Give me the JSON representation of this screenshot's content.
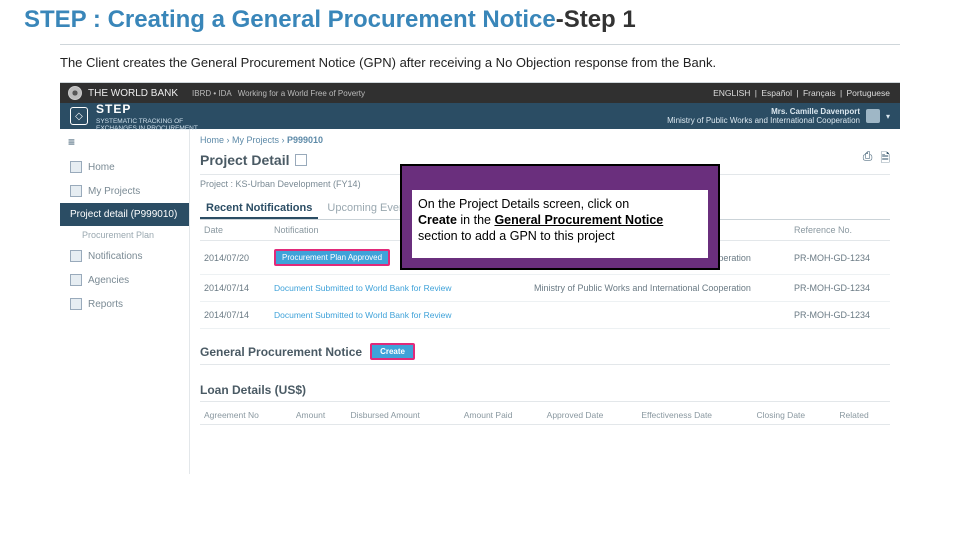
{
  "title": {
    "pre": "STEP : Creating a General Procurement Notice",
    "suffix": "-Step 1"
  },
  "intro": "The Client creates the General Procurement Notice (GPN) after receiving a No Objection response from the Bank.",
  "wb": {
    "brand": "THE WORLD BANK",
    "sub": "IBRD • IDA",
    "motto": "Working for a World Free of Poverty"
  },
  "langs": {
    "en": "ENGLISH",
    "es": "Español",
    "fr": "Français",
    "pt": "Portuguese"
  },
  "step": {
    "brand": "STEP",
    "sub": "SYSTEMATIC TRACKING OF\nEXCHANGES IN PROCUREMENT"
  },
  "user": {
    "name": "Mrs. Camille Davenport",
    "org": "Ministry of Public Works and International Cooperation"
  },
  "breadcrumb": {
    "home": "Home",
    "proj": "My Projects",
    "id": "P999010"
  },
  "sidebar": {
    "home": "Home",
    "myprojects": "My Projects",
    "detail": "Project detail (P999010)",
    "plan": "Procurement Plan",
    "notifications": "Notifications",
    "agencies": "Agencies",
    "reports": "Reports"
  },
  "project": {
    "title": "Project Detail",
    "sub": "Project : KS-Urban Development (FY14)"
  },
  "tabs": {
    "recent": "Recent Notifications",
    "upcoming": "Upcoming Events"
  },
  "notif": {
    "h_date": "Date",
    "h_notif": "Notification",
    "h_ref": "Reference No.",
    "rows": [
      {
        "date": "2014/07/20",
        "notif_badge": "Procurement Plan Approved",
        "org": "Ministry of Public Works and International Cooperation",
        "ref": "PR-MOH-GD-1234"
      },
      {
        "date": "2014/07/14",
        "notif_link": "Document Submitted to World Bank for Review",
        "org": "Ministry of Public Works and International Cooperation",
        "ref": "PR-MOH-GD-1234"
      },
      {
        "date": "2014/07/14",
        "notif_link": "Document Submitted to World Bank for Review",
        "org": "",
        "ref": "PR-MOH-GD-1234"
      }
    ]
  },
  "gpn": {
    "title": "General Procurement Notice",
    "create": "Create"
  },
  "loan": {
    "title": "Loan Details (US$)",
    "h": {
      "agr": "Agreement No",
      "amt": "Amount",
      "dis": "Disbursed Amount",
      "paid": "Amount Paid",
      "appr": "Approved Date",
      "eff": "Effectiveness Date",
      "close": "Closing Date",
      "rel": "Related"
    }
  },
  "callout": {
    "l1": "On the Project Details screen, click on",
    "l2a": "Create",
    "l2b": " in the ",
    "l2c": "General Procurement Notice",
    "l3": "section to add a GPN to this project"
  }
}
